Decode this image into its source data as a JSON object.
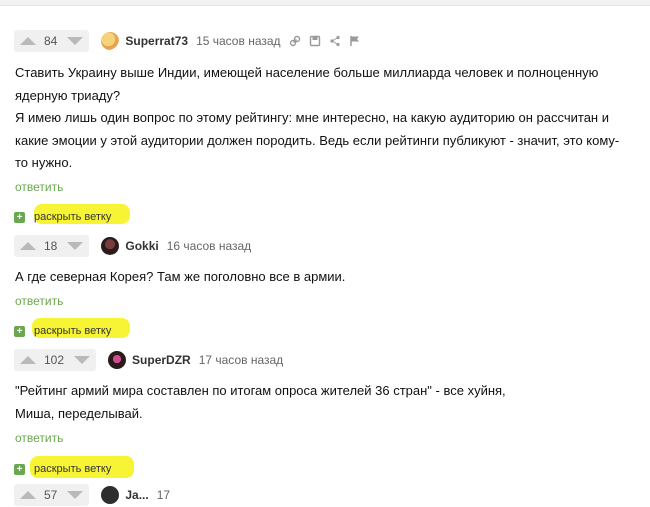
{
  "comments": [
    {
      "rating": "84",
      "author": "Superrat73",
      "time": "15 часов назад",
      "text_lines": [
        "Ставить Украину выше Индии, имеющей население больше миллиарда человек и полноценную",
        "ядерную триаду?",
        "Я имею лишь один вопрос по этому рейтингу: мне интересно, на какую аудиторию он рассчитан и",
        "какие эмоции у этой аудитории должен породить. Ведь если рейтинги публикуют - значит, это кому-",
        "то нужно."
      ],
      "reply": "ответить",
      "expand": "раскрыть ветку"
    },
    {
      "rating": "18",
      "author": "Gokki",
      "time": "16 часов назад",
      "text_lines": [
        "А где северная Корея? Там же поголовно все в армии."
      ],
      "reply": "ответить",
      "expand": "раскрыть ветку"
    },
    {
      "rating": "102",
      "author": "SuperDZR",
      "time": "17 часов назад",
      "text_lines": [
        "\"Рейтинг армий мира составлен по итогам опроса жителей 36 стран\" - все хуйня,",
        "Миша, переделывай."
      ],
      "reply": "ответить",
      "expand": "раскрыть ветку"
    },
    {
      "rating": "57",
      "author": "Ja...",
      "time": "17"
    }
  ],
  "icons": {
    "vote_up": "arrow-up",
    "vote_down": "arrow-down",
    "link": "link-icon",
    "save": "save-icon",
    "share": "share-icon",
    "report": "flag-icon"
  },
  "colors": {
    "accent_green": "#6aa84f",
    "highlight_yellow": "#f7f32a"
  }
}
